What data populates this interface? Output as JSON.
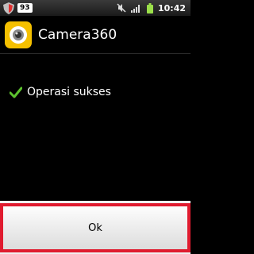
{
  "status_bar": {
    "notification_count": "93",
    "time": "10:42",
    "icons": [
      "shield-icon",
      "mute-icon",
      "signal-icon",
      "battery-icon"
    ]
  },
  "header": {
    "app_title": "Camera360",
    "app_icon": "camera360-icon"
  },
  "dialog": {
    "message": "Operasi sukses",
    "message_icon": "check-icon"
  },
  "buttons": {
    "ok_label": "Ok"
  },
  "colors": {
    "accent_check": "#5cc22e",
    "highlight_border": "#e01b2f",
    "app_icon_bg": "#f5c000"
  }
}
